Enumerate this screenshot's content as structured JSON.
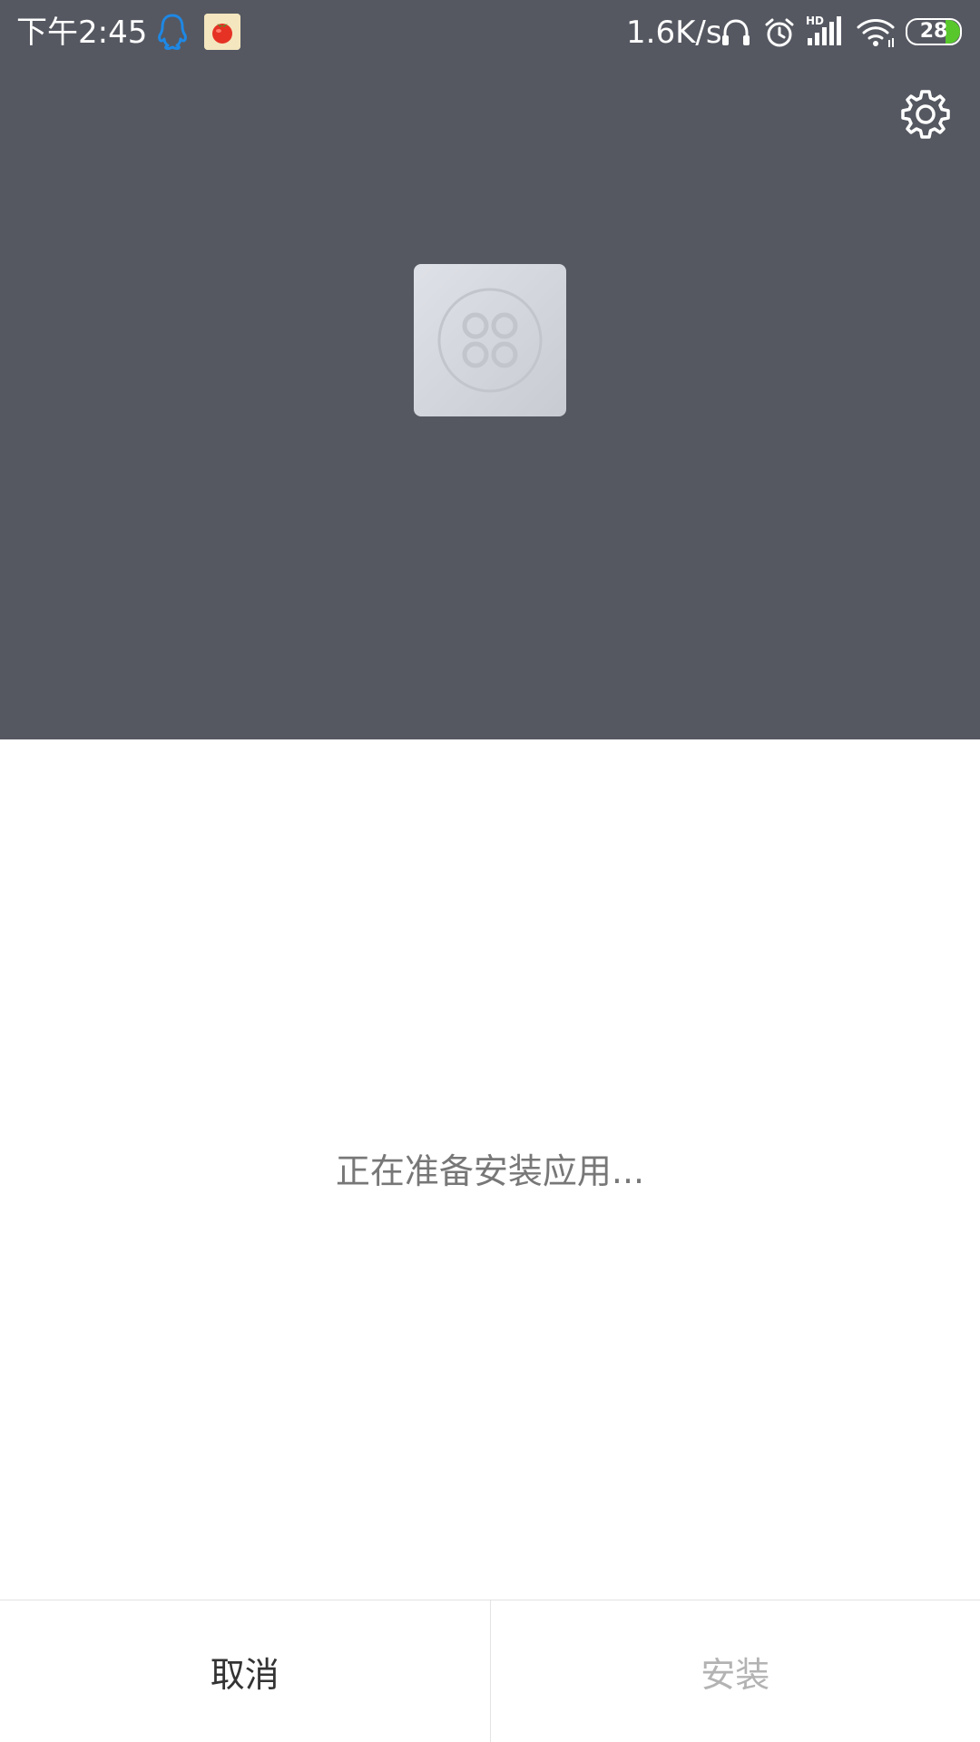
{
  "status_bar": {
    "time": "下午2:45",
    "network_speed": "1.6K/s",
    "hd_label": "HD",
    "battery_level": "28",
    "icons": [
      "qq-icon",
      "app-notification-icon",
      "headset-icon",
      "alarm-icon",
      "signal-icon",
      "wifi-icon",
      "battery-icon"
    ]
  },
  "header": {
    "background_color": "#555861",
    "settings_icon": "gear-icon",
    "app_icon": "placeholder-app-icon"
  },
  "main": {
    "message": "正在准备安装应用..."
  },
  "actions": {
    "cancel_label": "取消",
    "install_label": "安装"
  },
  "colors": {
    "battery_fill": "#58c72c",
    "qq_blue": "#1e88e5",
    "disabled_text": "#b3b3b3"
  }
}
